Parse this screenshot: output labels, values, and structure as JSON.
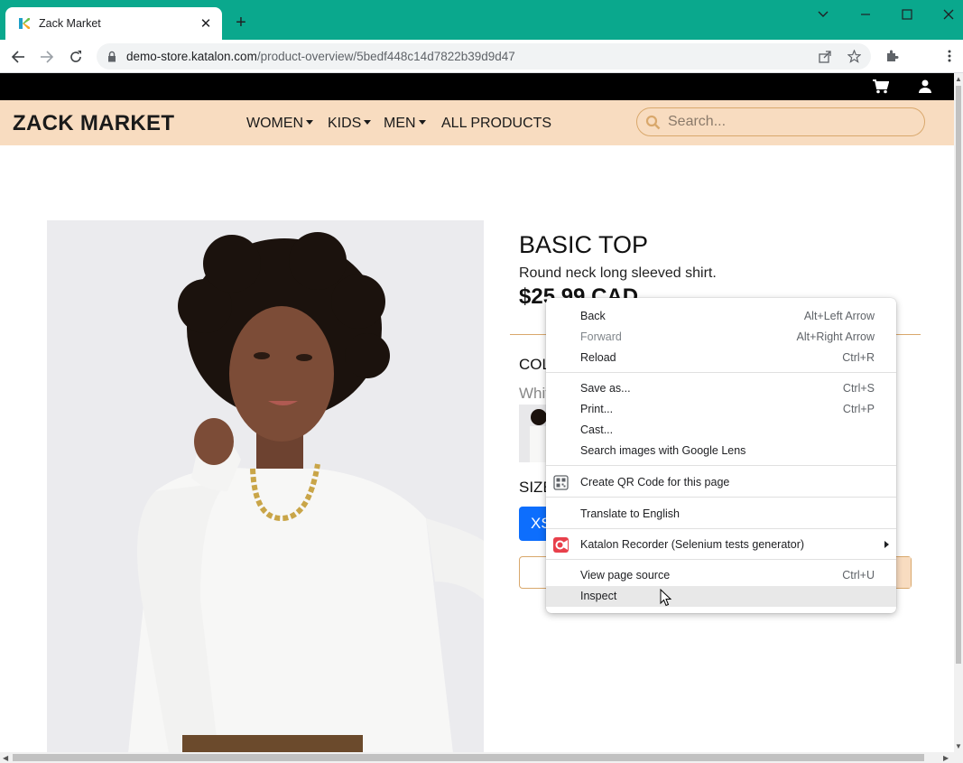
{
  "browser": {
    "tab_title": "Zack Market",
    "tab_close": "✕",
    "new_tab": "+",
    "url_host": "demo-store.katalon.com",
    "url_path": "/product-overview/5bedf448c14d7822b39d9d47",
    "theme_color": "#0aa88d",
    "icons": [
      "katalon-favicon",
      "back-icon",
      "forward-icon",
      "reload-icon",
      "lock-icon",
      "share-icon",
      "star-icon",
      "extensions-icon",
      "menu-icon",
      "minimize-icon",
      "maximize-icon",
      "close-icon",
      "tab-search-icon"
    ]
  },
  "site": {
    "brand": "ZACK MARKET",
    "nav": {
      "women": "WOMEN",
      "kids": "KIDS",
      "men": "MEN",
      "all_products": "ALL PRODUCTS"
    },
    "search_placeholder": "Search...",
    "header_color": "#f8dcc0"
  },
  "product": {
    "title": "BASIC TOP",
    "description": "Round neck long sleeved shirt.",
    "price": "$25.99 CAD",
    "color_label": "COLOR",
    "color_value": "White",
    "size_label": "SIZE",
    "size_selected": "XS"
  },
  "context_menu": {
    "items": [
      {
        "label": "Back",
        "shortcut": "Alt+Left Arrow",
        "disabled": false
      },
      {
        "label": "Forward",
        "shortcut": "Alt+Right Arrow",
        "disabled": true
      },
      {
        "label": "Reload",
        "shortcut": "Ctrl+R",
        "disabled": false
      },
      {
        "label": "Save as...",
        "shortcut": "Ctrl+S",
        "disabled": false
      },
      {
        "label": "Print...",
        "shortcut": "Ctrl+P",
        "disabled": false
      },
      {
        "label": "Cast...",
        "shortcut": "",
        "disabled": false
      },
      {
        "label": "Search images with Google Lens",
        "shortcut": "",
        "disabled": false
      },
      {
        "label": "Create QR Code for this page",
        "shortcut": "",
        "disabled": false
      },
      {
        "label": "Translate to English",
        "shortcut": "",
        "disabled": false
      },
      {
        "label": "Katalon Recorder (Selenium tests generator)",
        "shortcut": "",
        "disabled": false
      },
      {
        "label": "View page source",
        "shortcut": "Ctrl+U",
        "disabled": false
      },
      {
        "label": "Inspect",
        "shortcut": "",
        "disabled": false
      }
    ],
    "hovered": "Inspect"
  }
}
